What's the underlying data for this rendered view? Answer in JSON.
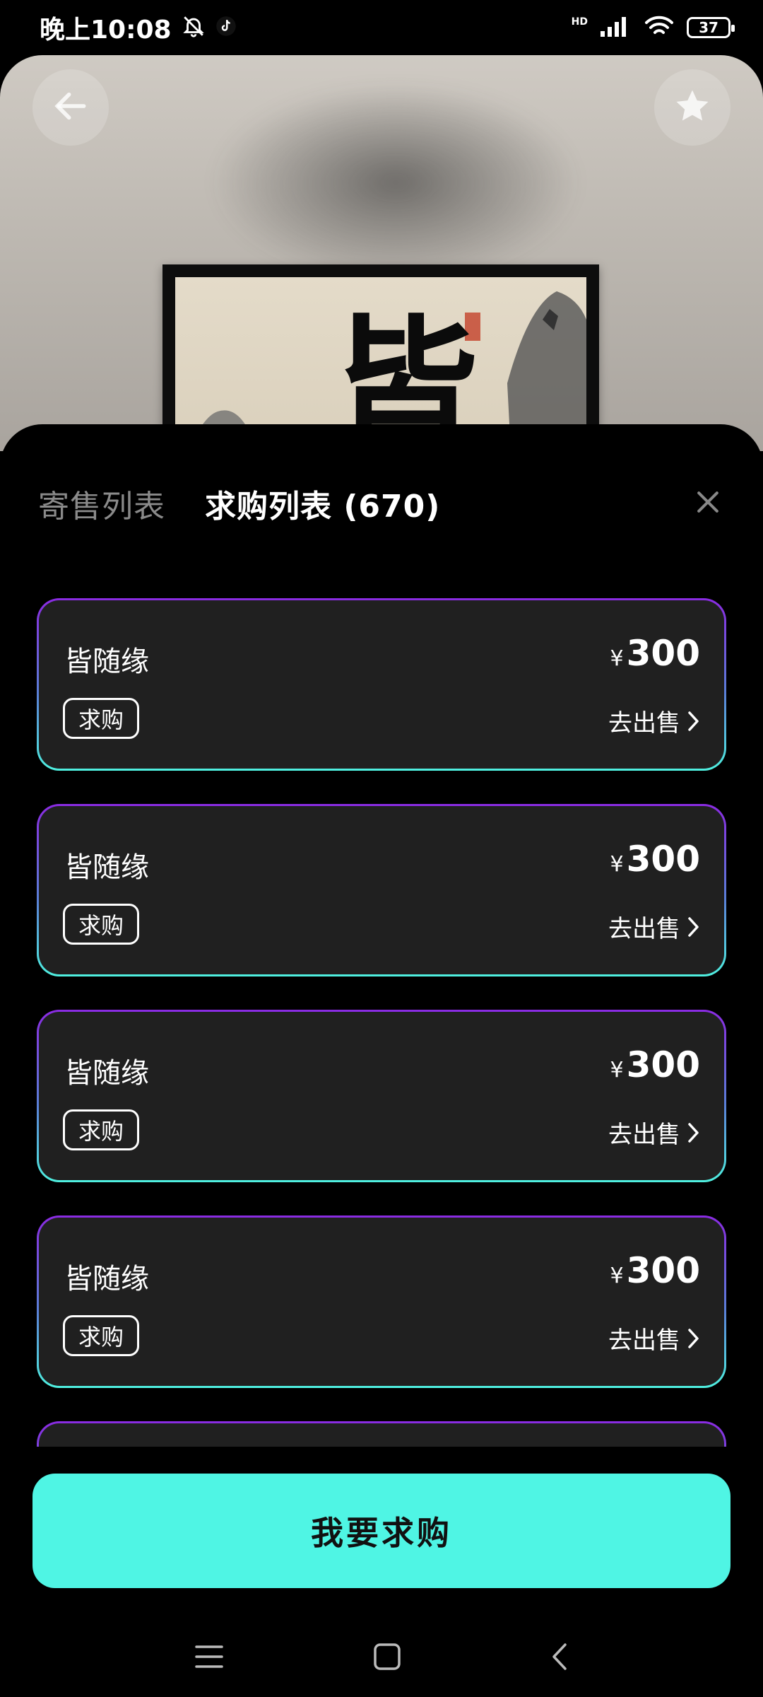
{
  "status_bar": {
    "time": "晚上10:08",
    "network": "HD",
    "battery": "37"
  },
  "hero": {
    "artwork_character": "皆",
    "icons": [
      "back-arrow-icon",
      "favorite-star-icon"
    ]
  },
  "sheet": {
    "tabs": [
      {
        "label": "寄售列表",
        "active": false
      },
      {
        "label": "求购列表 (670)",
        "active": true
      }
    ],
    "close_icon": "close-icon",
    "orders": [
      {
        "title": "皆随缘",
        "tag": "求购",
        "currency": "¥",
        "price": "300",
        "action": "去出售"
      },
      {
        "title": "皆随缘",
        "tag": "求购",
        "currency": "¥",
        "price": "300",
        "action": "去出售"
      },
      {
        "title": "皆随缘",
        "tag": "求购",
        "currency": "¥",
        "price": "300",
        "action": "去出售"
      },
      {
        "title": "皆随缘",
        "tag": "求购",
        "currency": "¥",
        "price": "300",
        "action": "去出售"
      }
    ],
    "cta_label": "我要求购"
  },
  "colors": {
    "accent": "#4ff5e4",
    "card_bg": "#202020",
    "border_top": "#8a2be2",
    "border_bottom": "#4ff0e0"
  },
  "nav": {
    "icons": [
      "menu-icon",
      "home-icon",
      "back-icon"
    ]
  }
}
